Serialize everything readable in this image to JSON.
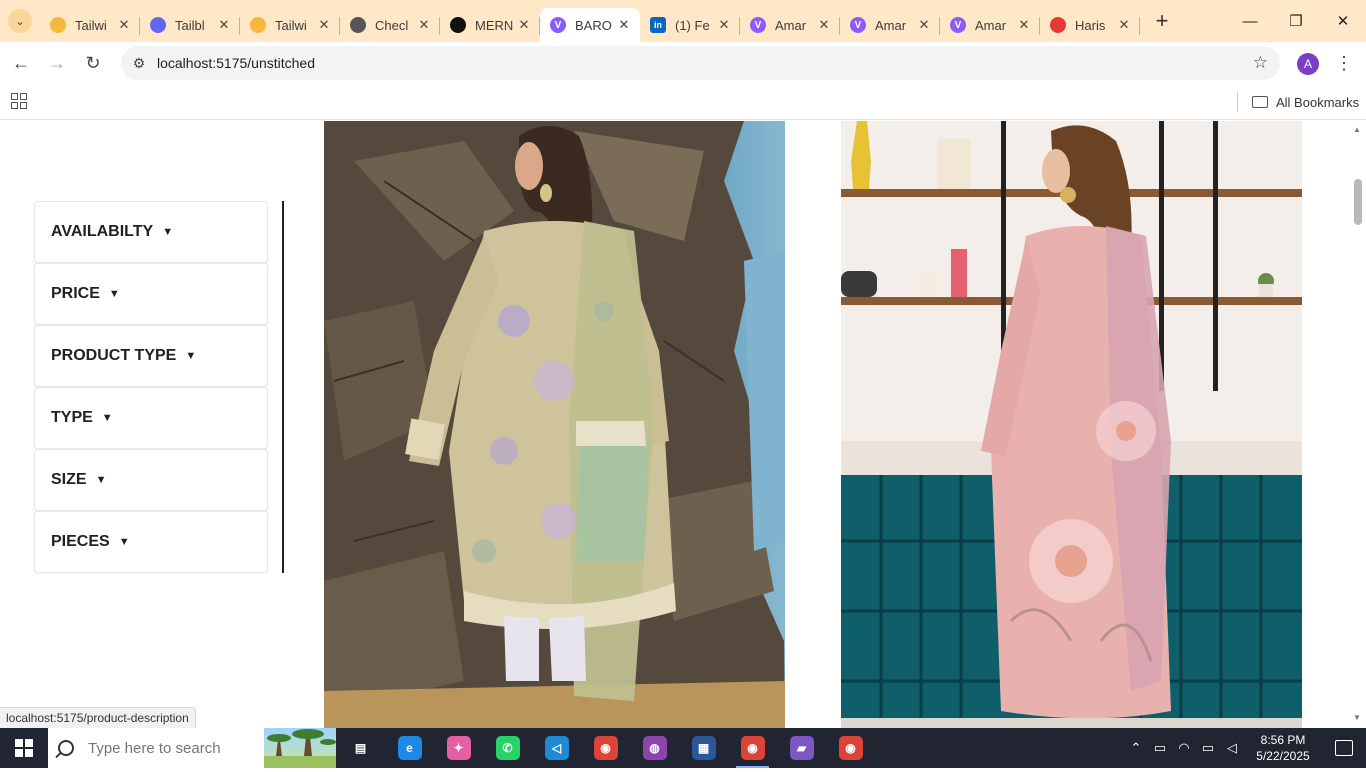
{
  "browser": {
    "tabs": [
      {
        "title": "Tailwi",
        "favicon": "smiley-icon",
        "color": "#f6b73c"
      },
      {
        "title": "Tailbl",
        "favicon": "tailblocks-icon",
        "color": "#6366f1"
      },
      {
        "title": "Tailwi",
        "favicon": "smiley-icon",
        "color": "#f6b73c"
      },
      {
        "title": "Checl",
        "favicon": "globe-icon",
        "color": "#555555"
      },
      {
        "title": "MERN",
        "favicon": "openai-icon",
        "color": "#111111"
      },
      {
        "title": "BARO",
        "favicon": "vite-icon",
        "color": "#8b5cf6",
        "active": true
      },
      {
        "title": "(1) Fe",
        "favicon": "linkedin-icon",
        "color": "#0a66c2"
      },
      {
        "title": "Amar",
        "favicon": "vite-icon",
        "color": "#8b5cf6"
      },
      {
        "title": "Amar",
        "favicon": "vite-icon",
        "color": "#8b5cf6"
      },
      {
        "title": "Amar",
        "favicon": "vite-icon",
        "color": "#8b5cf6"
      },
      {
        "title": "Haris",
        "favicon": "haris-icon",
        "color": "#e53935"
      }
    ],
    "address": "localhost:5175/unstitched",
    "profile_initial": "A",
    "bookmarks_label": "All Bookmarks"
  },
  "filters": [
    {
      "label": "AVAILABILTY"
    },
    {
      "label": "PRICE"
    },
    {
      "label": "PRODUCT TYPE"
    },
    {
      "label": "TYPE"
    },
    {
      "label": "SIZE"
    },
    {
      "label": "PIECES"
    }
  ],
  "status_url": "localhost:5175/product-description",
  "taskbar": {
    "search_placeholder": "Type here to search",
    "time": "8:56 PM",
    "date": "5/22/2025",
    "apps": [
      {
        "name": "task-view-icon",
        "color": "#202531",
        "glyph": "▤"
      },
      {
        "name": "edge-icon",
        "color": "#1e88e5",
        "glyph": "e"
      },
      {
        "name": "copilot-icon",
        "color": "#e65fa2",
        "glyph": "✦"
      },
      {
        "name": "whatsapp-icon",
        "color": "#25d366",
        "glyph": "✆"
      },
      {
        "name": "vscode-icon",
        "color": "#1f8ad2",
        "glyph": "◁"
      },
      {
        "name": "chrome-icon",
        "color": "#db4437",
        "glyph": "◉"
      },
      {
        "name": "github-desktop-icon",
        "color": "#8e44ad",
        "glyph": "◍"
      },
      {
        "name": "calculator-icon",
        "color": "#2b579a",
        "glyph": "▦"
      },
      {
        "name": "chrome-profile-icon",
        "color": "#db4437",
        "glyph": "◉",
        "active": true
      },
      {
        "name": "clapper-icon",
        "color": "#7e57c2",
        "glyph": "▰"
      },
      {
        "name": "chrome-profile-2-icon",
        "color": "#db4437",
        "glyph": "◉"
      }
    ]
  }
}
